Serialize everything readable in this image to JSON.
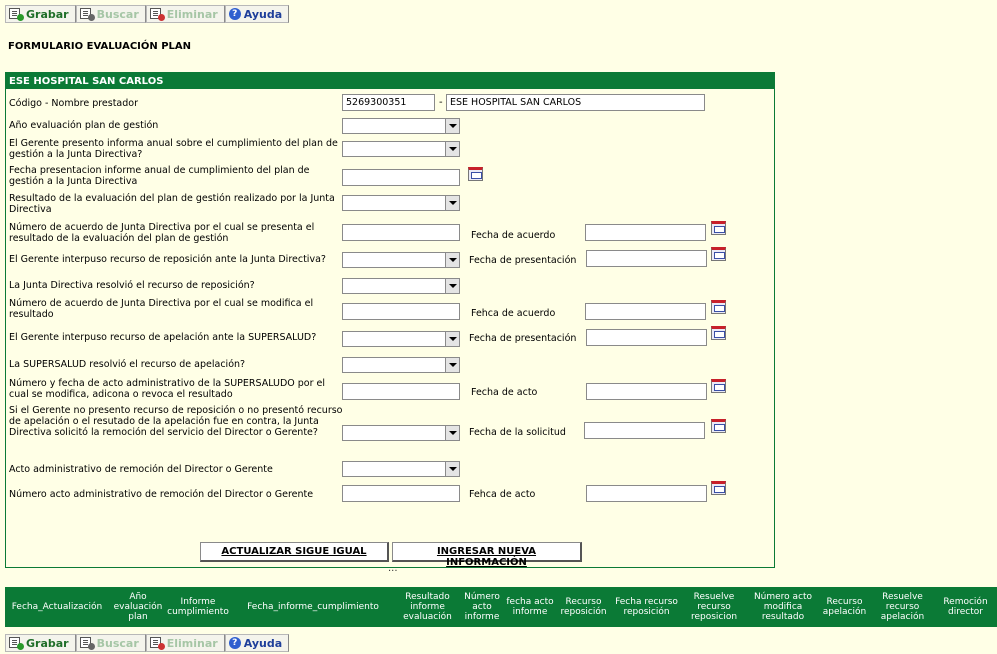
{
  "toolbar": {
    "grabar": "Grabar",
    "buscar": "Buscar",
    "eliminar": "Eliminar",
    "ayuda": "Ayuda"
  },
  "form_title": "FORMULARIO EVALUACIÓN PLAN",
  "panel_title": "ESE HOSPITAL SAN CARLOS",
  "fields": {
    "prestador_label": "Código - Nombre prestador",
    "prestador_code": "5269300351",
    "prestador_name": "ESE HOSPITAL SAN CARLOS",
    "anio_label": "Año evaluación plan de gestión",
    "informe_label": "El Gerente presento informa anual sobre el cumplimiento del plan de gestión a la Junta Directiva?",
    "fecha_informe_label": "Fecha presentacion informe anual de cumplimiento del plan de gestión a la Junta Directiva",
    "resultado_label": "Resultado de la evaluación del plan de gestión realizado por la Junta Directiva",
    "numero_acuerdo_label": "Número   de acuerdo de Junta Directiva por el cual se presenta el resultado de la evaluación del plan de gestión",
    "fecha_acuerdo_label": "Fecha  de  acuerdo",
    "reposicion_label": "El Gerente interpuso recurso de reposición ante la Junta Directiva?",
    "fecha_presentacion_label": "Fecha de presentación",
    "resolvio_reposicion_label": "La Junta Directiva resolvió el recurso de reposición?",
    "numero_modifica_label": "Número de acuerdo de Junta Directiva por el cual se modifica el resultado",
    "fehca_acuerdo_label": "Fehca  de  acuerdo",
    "apelacion_label": "El Gerente interpuso  recurso de apelación ante la SUPERSALUD?",
    "fecha_presentacion2_label": "Fecha de presentación",
    "resolvio_apelacion_label": "La SUPERSALUD resolvió el recurso de apelación?",
    "acto_supersalud_label": "Número y fecha de acto administrativo de la SUPERSALUDO por el cual se modifica, adicona o revoca el resultado",
    "fecha_acto_label": "Fecha  de  acto",
    "remocion_solicitud_label": "Si el Gerente no presento recurso de reposición o no presentó recurso de apelación o el resutado de la apelación fue en contra, la Junta Directiva solicitó la remoción del servicio del Director o Gerente?",
    "fecha_solicitud_label": "Fecha de la solicitud",
    "acto_remocion_label": "Acto administrativo de remoción del Director o Gerente",
    "numero_acto_remocion_label": "Número acto administrativo de remoción del Director o Gerente",
    "fehca_acto_label": "Fehca  de  acto"
  },
  "buttons": {
    "actualizar": "ACTUALIZAR SIGUE IGUAL",
    "ingresar": "INGRESAR NUEVA INFORMACIÓN",
    "dots": "..."
  },
  "grid_columns": [
    "Fecha_Actualización",
    "Año evaluación plan",
    "Informe cumplimiento",
    "Fecha_informe_cumplimiento",
    "Resultado informe evaluación",
    "Número acto informe",
    "fecha acto informe",
    "Recurso reposición",
    "Fecha recurso reposición",
    "Resuelve recurso reposicion",
    "Número acto modifica resultado",
    "Recurso apelación",
    "Resuelve recurso apelación",
    "Remoción director"
  ]
}
